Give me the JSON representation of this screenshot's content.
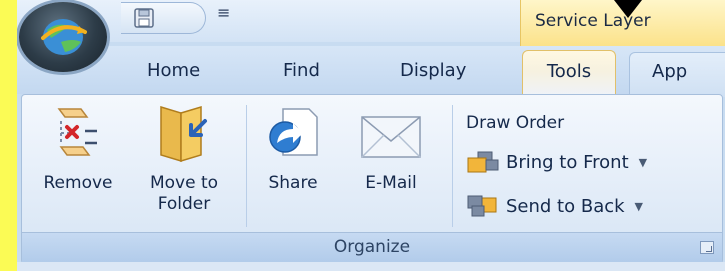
{
  "quick_access": {
    "save_icon": "save-disk-icon",
    "dropdown_glyph": "≡"
  },
  "context_tab": {
    "label": "Service Layer"
  },
  "tabs": [
    {
      "label": "Home"
    },
    {
      "label": "Find"
    },
    {
      "label": "Display"
    },
    {
      "label": "Tools",
      "active": true
    },
    {
      "label": "App"
    }
  ],
  "ribbon": {
    "group_label": "Organize",
    "buttons": {
      "remove": "Remove",
      "move_to_folder_line1": "Move to",
      "move_to_folder_line2": "Folder",
      "share": "Share",
      "email": "E-Mail"
    },
    "draw_order": {
      "label": "Draw Order",
      "bring_to_front": "Bring to Front",
      "send_to_back": "Send to Back",
      "dropdown_glyph": "▼"
    }
  },
  "colors": {
    "page_background": "#fbfb55",
    "active_tab_accent": "#e1c06a",
    "ribbon_border": "#a7bfdc"
  }
}
